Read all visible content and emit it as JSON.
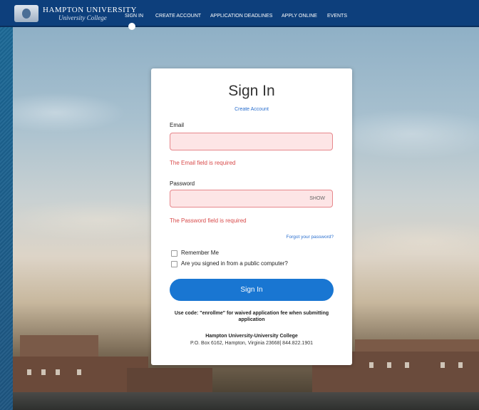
{
  "nav": {
    "brand": {
      "name": "HAMPTON UNIVERSITY",
      "sub": "University College"
    },
    "links": [
      {
        "label": "SIGN IN"
      },
      {
        "label": "CREATE ACCOUNT"
      },
      {
        "label": "APPLICATION DEADLINES"
      },
      {
        "label": "APPLY ONLINE"
      },
      {
        "label": "EVENTS"
      }
    ]
  },
  "form": {
    "title": "Sign In",
    "create_account": "Create Account",
    "email": {
      "label": "Email",
      "value": "",
      "error": "The Email field is required"
    },
    "password": {
      "label": "Password",
      "value": "",
      "show": "SHOW",
      "error": "The Password field is required"
    },
    "forgot": "Forgot your password?",
    "remember_me": "Remember Me",
    "public_computer": "Are you signed in from a public computer?",
    "submit": "Sign In",
    "promo": "Use code: \"enrollme\" for waived application fee when submitting application",
    "footer": {
      "name": "Hampton University-University College",
      "address": "P.O. Box 6162, Hampton, Virginia 23668| 844.822.1901"
    }
  },
  "colors": {
    "nav": "#0d3f7c",
    "accent": "#1976d2",
    "error": "#d84a4a",
    "error_bg": "#fde5e6"
  }
}
